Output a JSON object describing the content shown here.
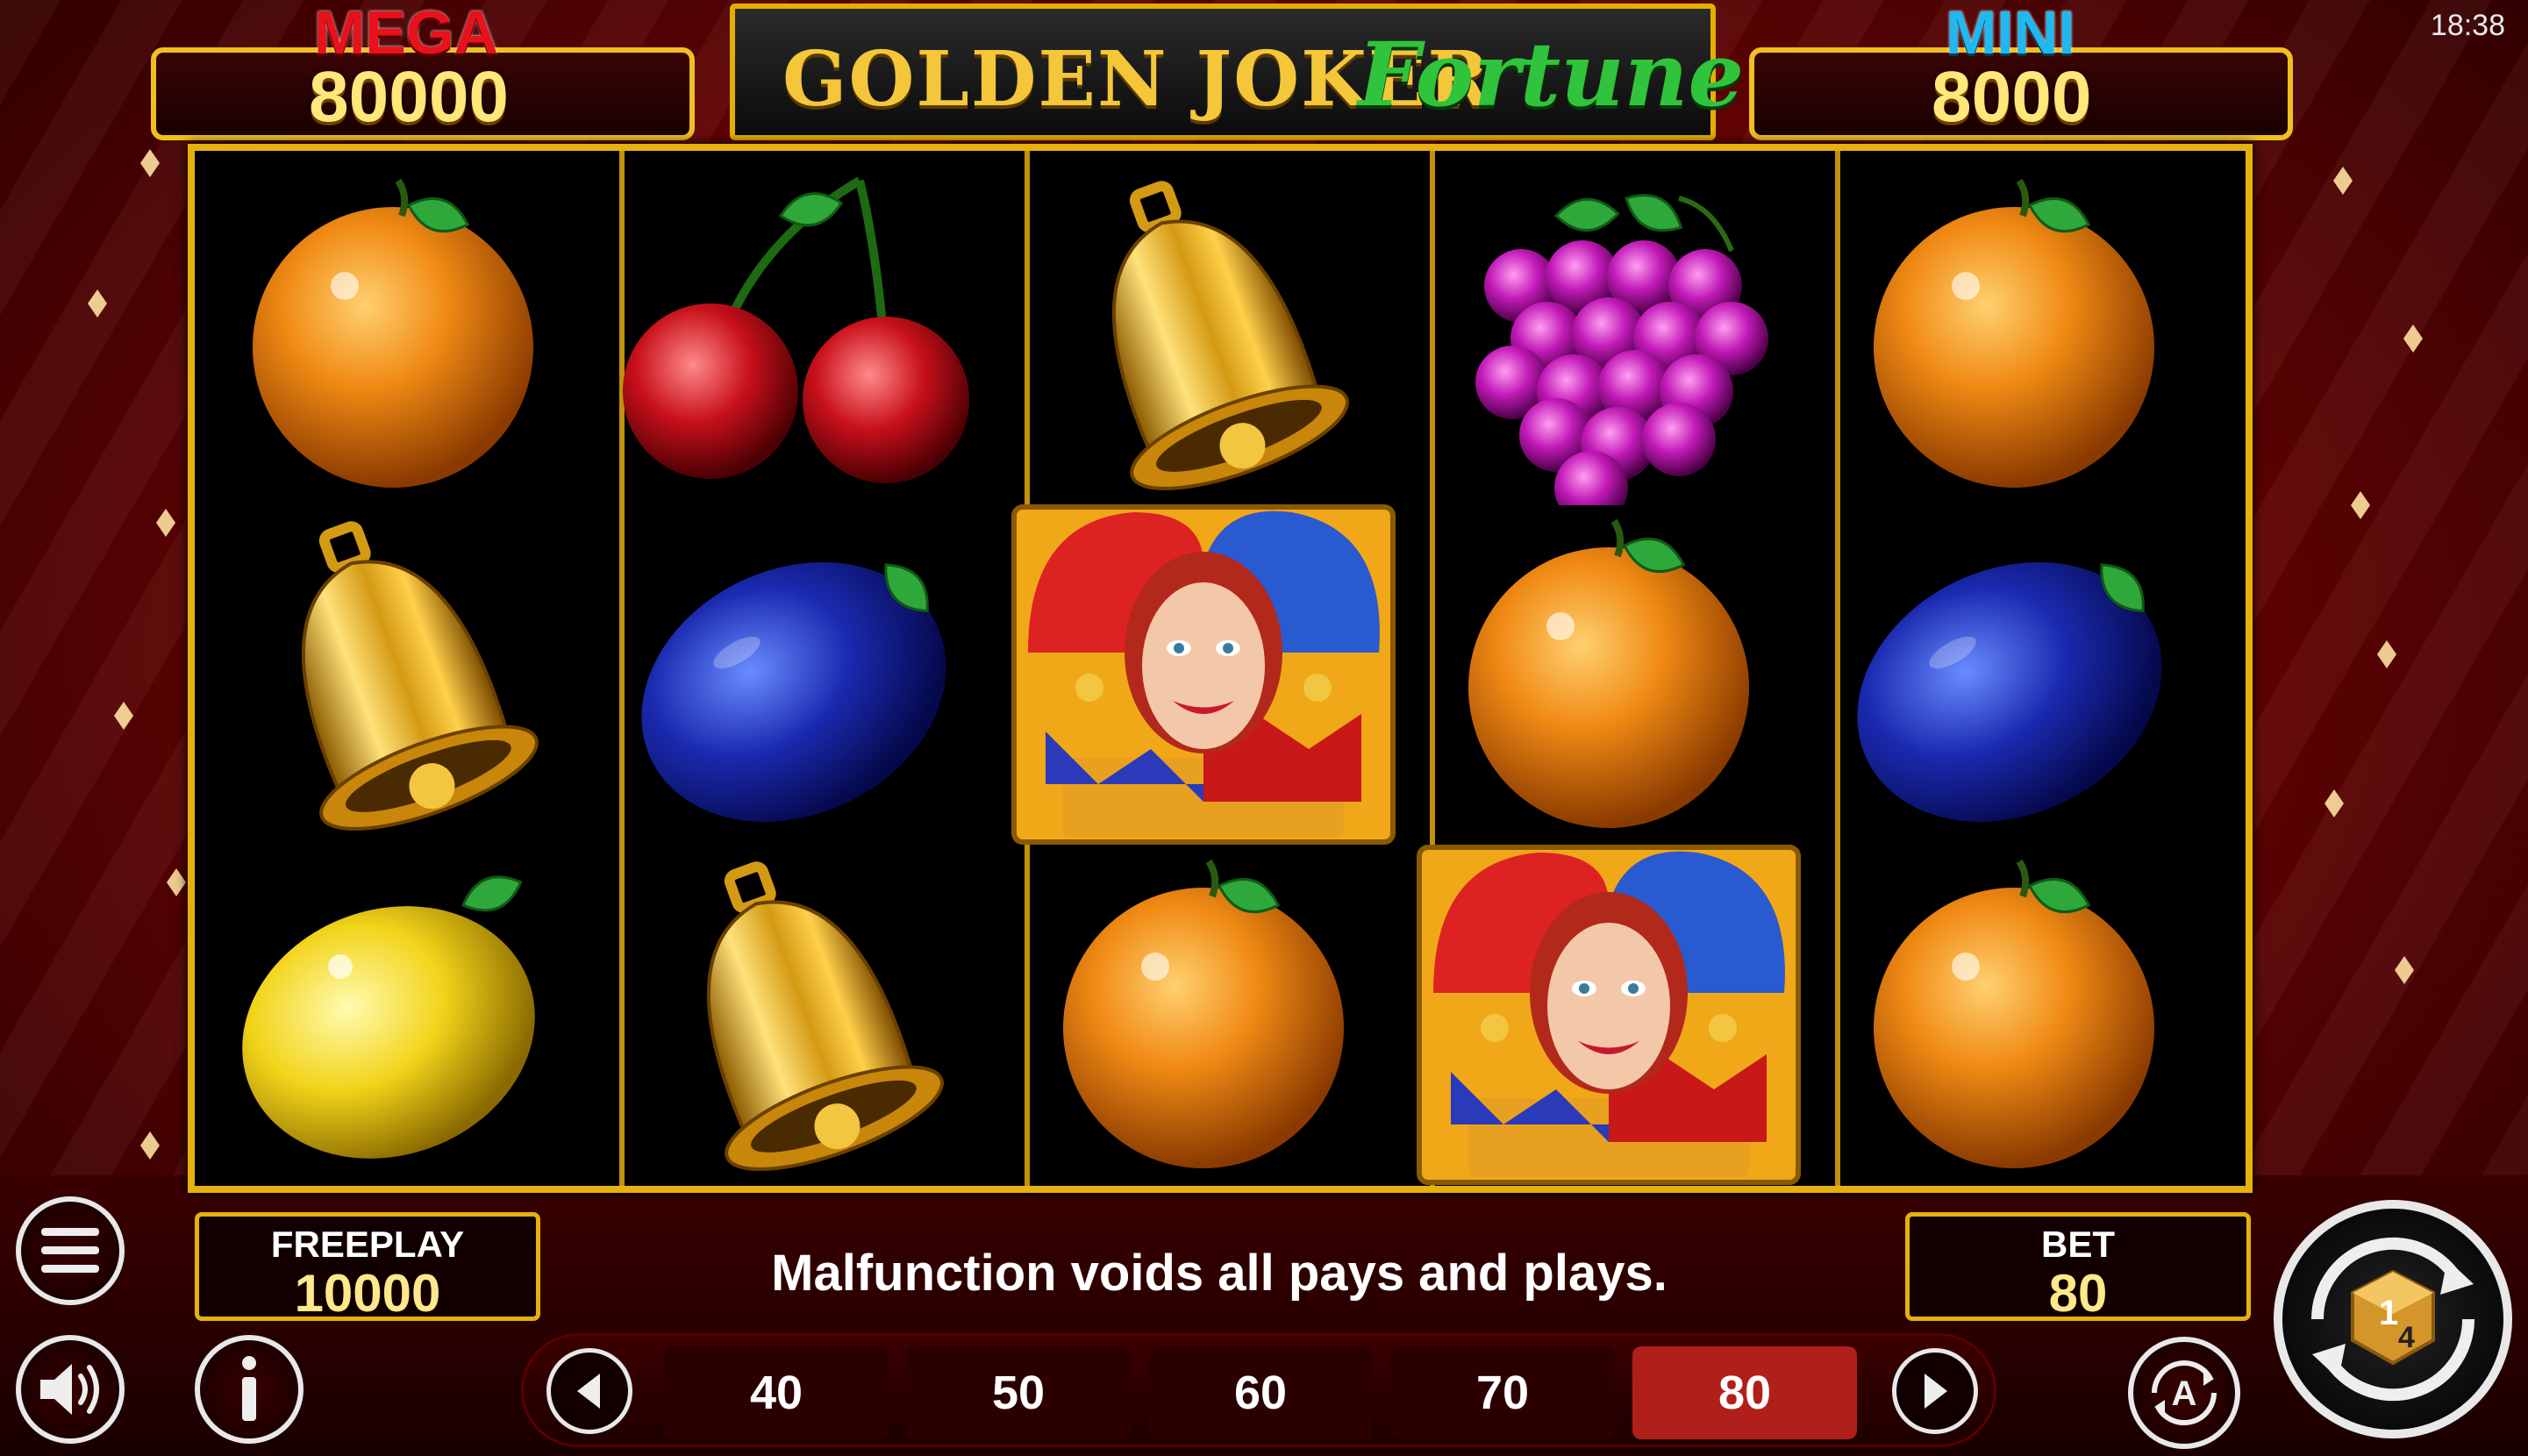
{
  "status_bar": {
    "time": "18:38"
  },
  "jackpots": {
    "mega": {
      "label": "MEGA",
      "value": "80000",
      "label_color": "#e8111c"
    },
    "mini": {
      "label": "MINI",
      "value": "8000",
      "label_color": "#20b8f0"
    }
  },
  "logo": {
    "word1": "GOLDEN JOKER",
    "word2": "Fortune"
  },
  "reels": [
    [
      "orange",
      "bell",
      "lemon"
    ],
    [
      "cherry",
      "plum",
      "bell"
    ],
    [
      "bell",
      "joker",
      "orange"
    ],
    [
      "grapes",
      "orange",
      "joker"
    ],
    [
      "orange",
      "plum",
      "orange"
    ]
  ],
  "freeplay": {
    "label": "FREEPLAY",
    "value": "10000"
  },
  "bet": {
    "label": "BET",
    "value": "80"
  },
  "notice": "Malfunction voids all pays and plays.",
  "bet_options": [
    "40",
    "50",
    "60",
    "70",
    "80"
  ],
  "selected_bet": "80",
  "icons": {
    "menu": "menu-icon",
    "sound": "speaker-icon",
    "info": "info-icon",
    "autoplay": "autoplay-icon",
    "spin": "spin-icon",
    "prev": "chevron-left-icon",
    "next": "chevron-right-icon"
  },
  "colors": {
    "frame_gold": "#e6b10c",
    "accent_red": "#b01f1a",
    "value_yellow": "#ffe88a"
  }
}
